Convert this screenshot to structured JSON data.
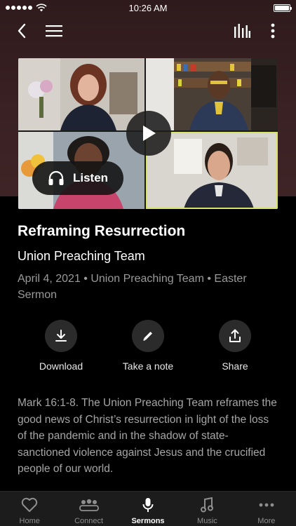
{
  "status_bar": {
    "time": "10:26 AM"
  },
  "toolbar": {
    "back_label": "Back",
    "menu_label": "Menu",
    "queue_label": "Queue",
    "more_label": "More options"
  },
  "player": {
    "listen_label": "Listen"
  },
  "sermon": {
    "title": "Reframing Resurrection",
    "speaker": "Union Preaching Team",
    "meta": "April 4, 2021 • Union Preaching Team • Easter Sermon",
    "description": "Mark 16:1-8. The Union Preaching Team reframes the good news of Christ’s resurrection in light of the loss of the pandemic and in the shadow of state-sanctioned violence against Jesus and the crucified people of our world."
  },
  "actions": {
    "download": "Download",
    "note": "Take a note",
    "share": "Share"
  },
  "tabs": [
    {
      "label": "Home",
      "icon": "heart-icon"
    },
    {
      "label": "Connect",
      "icon": "people-icon"
    },
    {
      "label": "Sermons",
      "icon": "microphone-icon"
    },
    {
      "label": "Music",
      "icon": "music-note-icon"
    },
    {
      "label": "More",
      "icon": "more-dots-icon"
    }
  ],
  "colors": {
    "accent_hero": "#3a2123",
    "tab_bar": "#1c1c1c",
    "active_tile_border": "#d6e26a"
  }
}
